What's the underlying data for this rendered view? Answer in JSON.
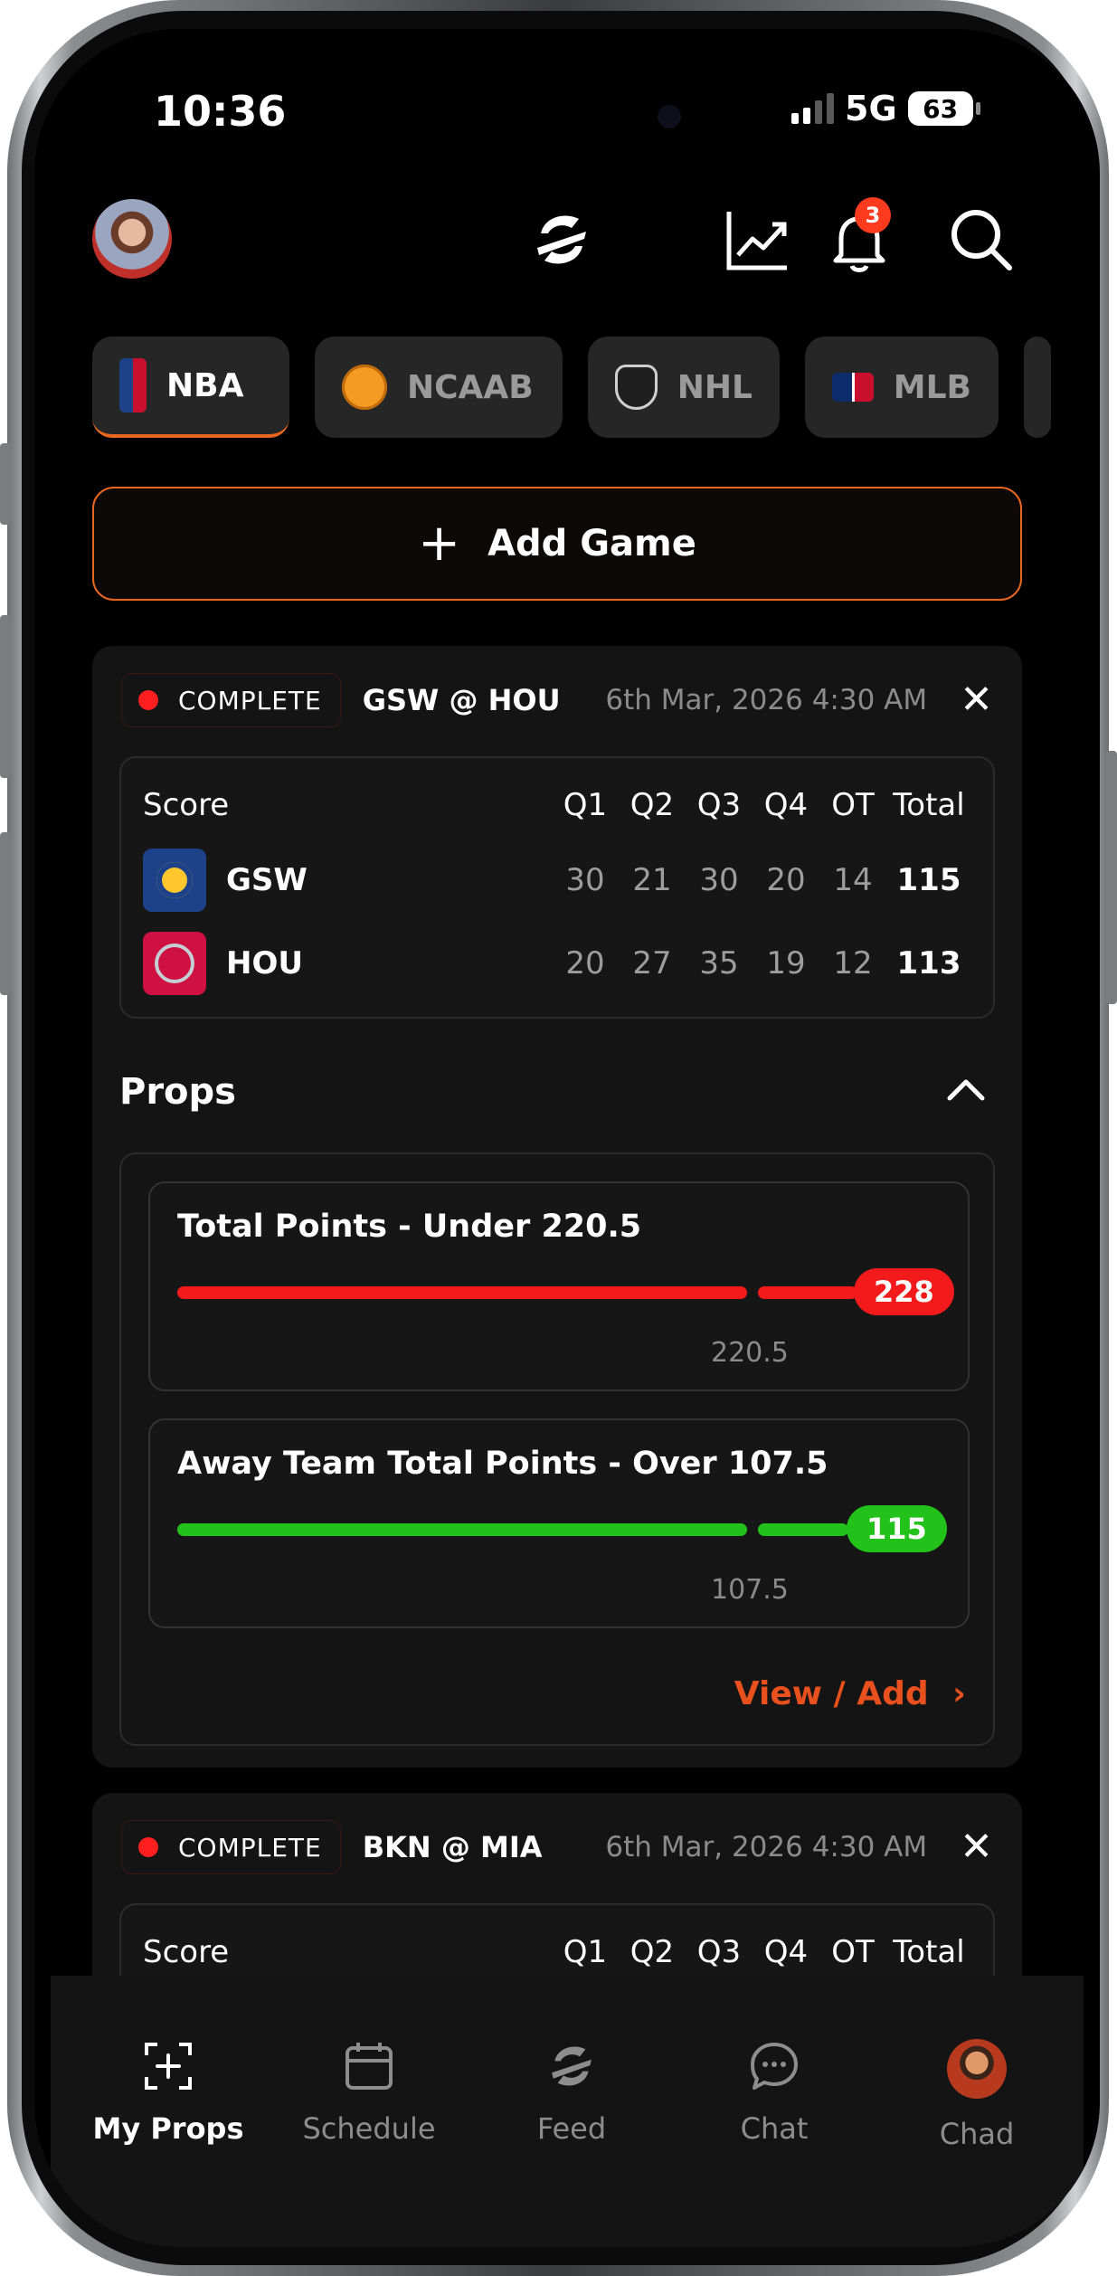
{
  "status_bar": {
    "time": "10:36",
    "network": "5G",
    "battery": "63"
  },
  "header": {
    "notification_count": "3"
  },
  "league_tabs": [
    {
      "label": "NBA",
      "active": true
    },
    {
      "label": "NCAAB",
      "active": false
    },
    {
      "label": "NHL",
      "active": false
    },
    {
      "label": "MLB",
      "active": false
    }
  ],
  "add_game": {
    "label": "Add Game"
  },
  "games": [
    {
      "status": "COMPLETE",
      "matchup": "GSW @ HOU",
      "date": "6th Mar, 2026 4:30 AM",
      "score_header": {
        "label": "Score",
        "cols": [
          "Q1",
          "Q2",
          "Q3",
          "Q4",
          "OT",
          "Total"
        ]
      },
      "teams": [
        {
          "abbr": "GSW",
          "scores": [
            "30",
            "21",
            "30",
            "20",
            "14"
          ],
          "total": "115"
        },
        {
          "abbr": "HOU",
          "scores": [
            "20",
            "27",
            "35",
            "19",
            "12"
          ],
          "total": "113"
        }
      ],
      "props_title": "Props",
      "props": [
        {
          "title": "Total Points - Under 220.5",
          "value": "228",
          "line": "220.5",
          "color": "#f21a1a"
        },
        {
          "title": "Away Team Total Points - Over 107.5",
          "value": "115",
          "line": "107.5",
          "color": "#22c21a"
        }
      ],
      "view_add": "View / Add"
    },
    {
      "status": "COMPLETE",
      "matchup": "BKN @ MIA",
      "date": "6th Mar, 2026 4:30 AM",
      "score_header": {
        "label": "Score",
        "cols": [
          "Q1",
          "Q2",
          "Q3",
          "Q4",
          "OT",
          "Total"
        ]
      }
    }
  ],
  "bottom_nav": [
    {
      "label": "My Props",
      "icon": "add-square-icon",
      "active": true
    },
    {
      "label": "Schedule",
      "icon": "calendar-icon",
      "active": false
    },
    {
      "label": "Feed",
      "icon": "logo-icon",
      "active": false
    },
    {
      "label": "Chat",
      "icon": "chat-bubble-icon",
      "active": false
    },
    {
      "label": "Chad",
      "icon": "profile-avatar",
      "active": false
    }
  ],
  "colors": {
    "accent": "#e8661e",
    "link": "#e8501e",
    "live_dot": "#ff1f1f",
    "under": "#f21a1a",
    "over": "#22c21a"
  }
}
